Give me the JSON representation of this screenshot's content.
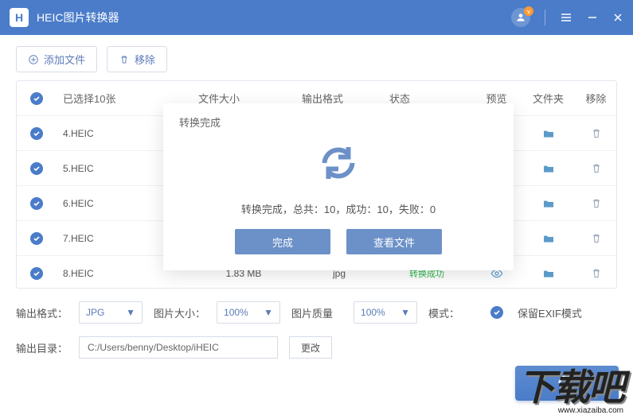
{
  "titlebar": {
    "app_name": "HEIC图片转换器"
  },
  "toolbar": {
    "add_label": "添加文件",
    "remove_label": "移除"
  },
  "table": {
    "headers": {
      "selected": "已选择10张",
      "size": "文件大小",
      "out_fmt": "输出格式",
      "status": "状态",
      "preview": "预览",
      "folder": "文件夹",
      "remove": "移除"
    },
    "rows": [
      {
        "name": "4.HEIC",
        "size": "",
        "fmt": "",
        "status": ""
      },
      {
        "name": "5.HEIC",
        "size": "",
        "fmt": "",
        "status": ""
      },
      {
        "name": "6.HEIC",
        "size": "",
        "fmt": "",
        "status": ""
      },
      {
        "name": "7.HEIC",
        "size": "",
        "fmt": "",
        "status": ""
      },
      {
        "name": "8.HEIC",
        "size": "1.83 MB",
        "fmt": "jpg",
        "status": "转换成功"
      }
    ]
  },
  "settings": {
    "out_fmt_label": "输出格式：",
    "out_fmt_value": "JPG",
    "img_size_label": "图片大小：",
    "img_size_value": "100%",
    "img_quality_label": "图片质量",
    "img_quality_value": "100%",
    "mode_label": "模式：",
    "mode_value": "保留EXIF模式",
    "out_dir_label": "输出目录：",
    "out_dir_value": "C:/Users/benny/Desktop/iHEIC",
    "change_label": "更改"
  },
  "modal": {
    "title": "转换完成",
    "message": "转换完成，总共：10，成功：10，失败：0",
    "done_btn": "完成",
    "view_btn": "查看文件"
  },
  "watermark": {
    "big": "下载吧",
    "url": "www.xiazaiba.com"
  }
}
